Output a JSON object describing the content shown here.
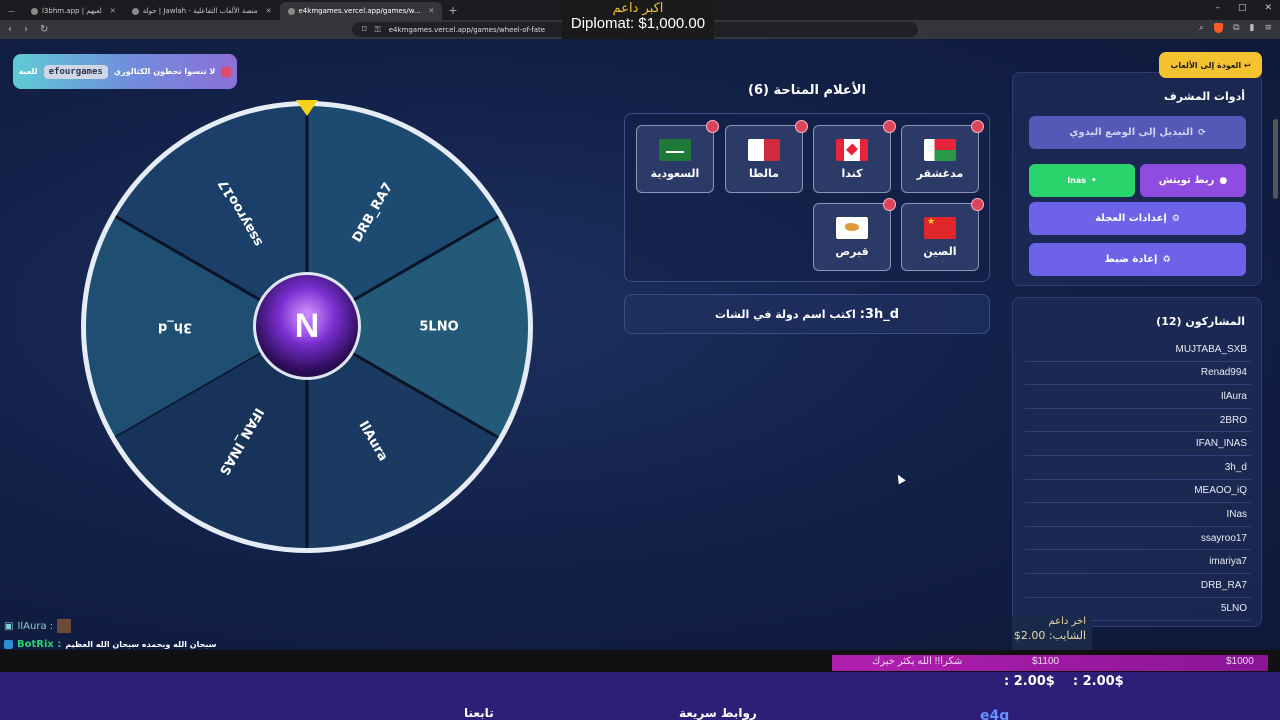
{
  "browser": {
    "tabs": [
      {
        "label": "—",
        "active": false
      },
      {
        "label": "l3bhm.app | لعبهم",
        "active": false
      },
      {
        "label": "جولة | Jawlah - منصة الألعاب التفاعلية",
        "active": false
      },
      {
        "label": "e4kmgames.vercel.app/games/w...",
        "active": true
      }
    ],
    "new_tab": "+",
    "url": "e4kmgames.vercel.app/games/wheel-of-fate",
    "window_controls": [
      "–",
      "□",
      "✕"
    ]
  },
  "stream_overlay_top": {
    "line1": "اكبر داعم",
    "line2": "Diplomat: $1,000.00"
  },
  "promo": {
    "text": "لا تنسوا تحطون الكثالوري",
    "brand": "efourgames",
    "suffix": "للعبة"
  },
  "wheel": {
    "segments": [
      "3h_d",
      "ssayroo17",
      "DRB_RA7",
      "5LNO",
      "IlAura",
      "IFAN_INAS"
    ],
    "colors": [
      "#1f4e73",
      "#1b3f68",
      "#1d4a70",
      "#235a78",
      "#1a3a62",
      "#17335a"
    ],
    "hub_letter": "N"
  },
  "flags": {
    "title": "الأعلام المتاحة (6)",
    "items": [
      {
        "name": "مدغشقر",
        "code": "mdg"
      },
      {
        "name": "كندا",
        "code": "can"
      },
      {
        "name": "مالطا",
        "code": "mlt"
      },
      {
        "name": "السعودية",
        "code": "sau"
      },
      {
        "name": "الصين",
        "code": "chn"
      },
      {
        "name": "قبرص",
        "code": "cyp"
      }
    ]
  },
  "prompt": {
    "player": "3h_d:",
    "text": "اكتب اسم دولة في الشات"
  },
  "admin": {
    "back_label": "↩ العودة إلى الألعاب",
    "title": "أدوات المشرف",
    "manual_mode": "التبديل إلى الوضع اليدوي",
    "twitch": "ربط تويتش",
    "user": "Inas",
    "settings": "إعدادات العجلة",
    "reset": "إعادة ضبط"
  },
  "participants": {
    "title": "المشاركون (12)",
    "names": [
      "MUJTABA_SXB",
      "Renad994",
      "IlAura",
      "2BRO",
      "IFAN_INAS",
      "3h_d",
      "MEAOO_iQ",
      "INas",
      "ssayroo17",
      "imariya7",
      "DRB_RA7",
      "5LNO"
    ]
  },
  "last_supporter": {
    "label": "اخر داعم",
    "value": "الشايب: 2.00$"
  },
  "chat": {
    "user1": "IlAura :",
    "bot": "BotRix :",
    "bot_msg": "سبحان الله وبحمده سبحان الله العظيم"
  },
  "goal_bar": {
    "left_text": "شكرا!! الله يكثر خيرك",
    "mid_value": "$1100",
    "right_value": "$1000"
  },
  "footer": {
    "donor1": "2.00$ :",
    "donor2": "2.00$ :",
    "follow": "تابعنا",
    "links": "روابط سريعة",
    "logo": "e4g"
  },
  "colors": {
    "accent_yellow": "#f5c230",
    "manual": "#5458b6",
    "twitch": "#8e4ce0",
    "user": "#2bd36d",
    "primary": "#6d63e8",
    "remove_badge": "#d9465c"
  },
  "icons": [
    "gift-icon",
    "refresh-icon",
    "twitch-icon",
    "gear-icon",
    "reset-icon",
    "back-arrow-icon",
    "lock-icon",
    "bookmark-icon",
    "shield-icon"
  ]
}
